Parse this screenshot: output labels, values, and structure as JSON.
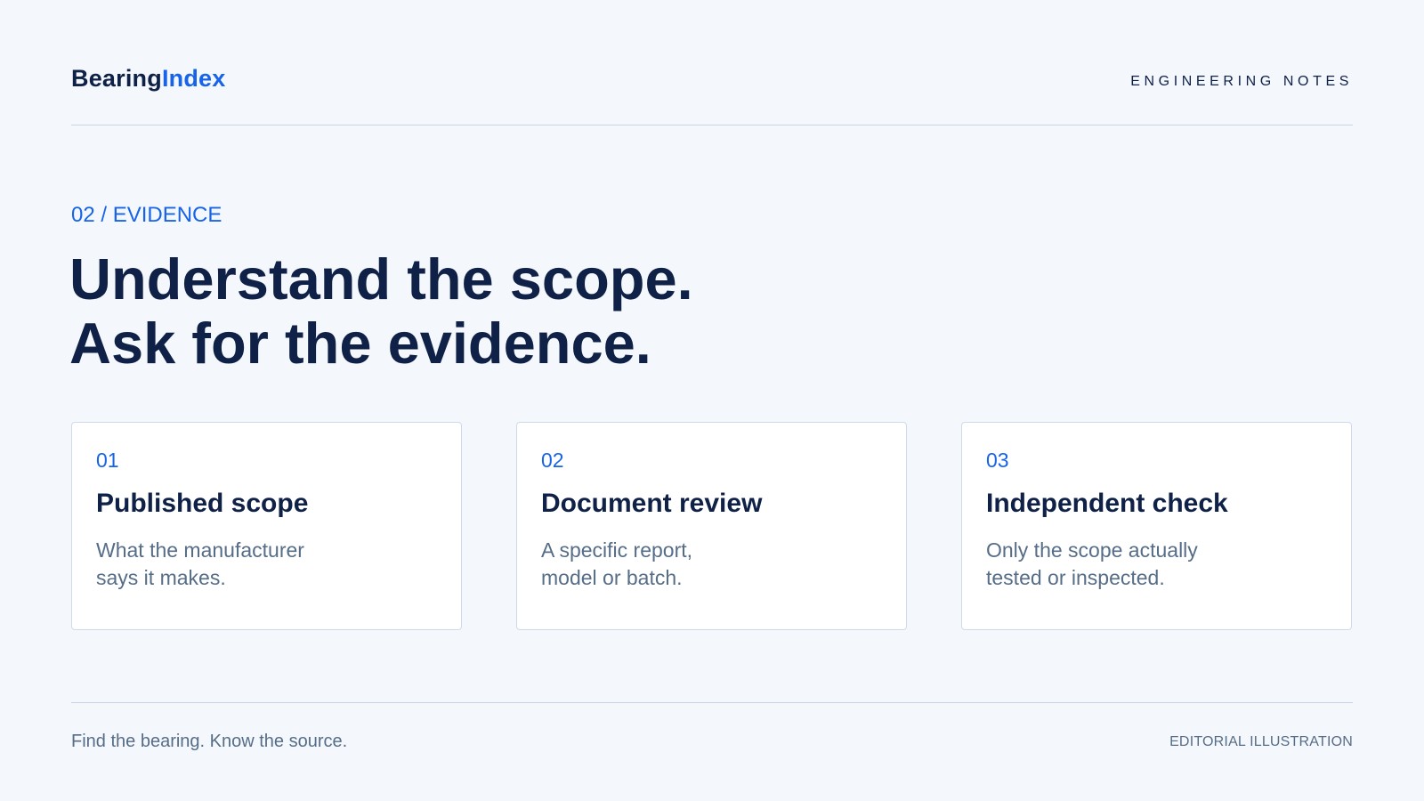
{
  "brand": {
    "name_part1": "Bearing",
    "name_part2": "Index"
  },
  "header": {
    "section_label": "ENGINEERING NOTES"
  },
  "kicker": "02 / EVIDENCE",
  "headline": {
    "line1": "Understand the scope.",
    "line2": "Ask for the evidence."
  },
  "cards": [
    {
      "number": "01",
      "title": "Published scope",
      "desc_line1": "What the manufacturer",
      "desc_line2": "says it makes."
    },
    {
      "number": "02",
      "title": "Document review",
      "desc_line1": "A specific report,",
      "desc_line2": "model or batch."
    },
    {
      "number": "03",
      "title": "Independent check",
      "desc_line1": "Only the scope actually",
      "desc_line2": "tested or inspected."
    }
  ],
  "footer": {
    "tagline": "Find the bearing. Know the source.",
    "credit": "EDITORIAL ILLUSTRATION"
  },
  "colors": {
    "background": "#f4f7fc",
    "navy": "#0f2147",
    "accent_blue": "#1764e8",
    "muted_text": "#566d88",
    "divider": "#c9d5e6"
  }
}
